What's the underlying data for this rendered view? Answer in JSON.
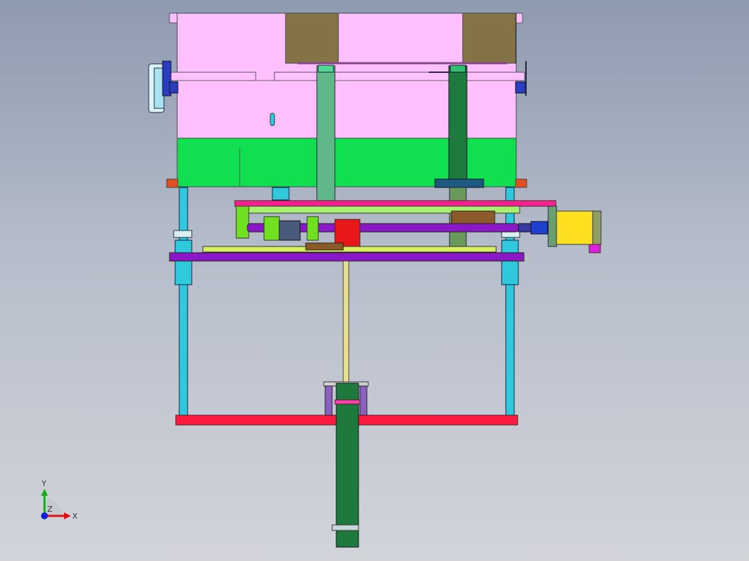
{
  "view": {
    "background_top": "#8e9ab0",
    "background_bottom": "#d2d4da"
  },
  "triad": {
    "x_label": "X",
    "y_label": "Y",
    "z_label": "Z",
    "x_color": "#e01010",
    "y_color": "#10b010",
    "z_color": "#1020e0"
  },
  "colors": {
    "pink": "#ffc0ff",
    "olive": "#857348",
    "green": "#10e050",
    "cyan": "#30c8dc",
    "purple": "#8a18c8",
    "red": "#ff1a40",
    "magenta": "#ff2090",
    "dark_green": "#1e7a3c",
    "yellow": "#ffe020"
  }
}
